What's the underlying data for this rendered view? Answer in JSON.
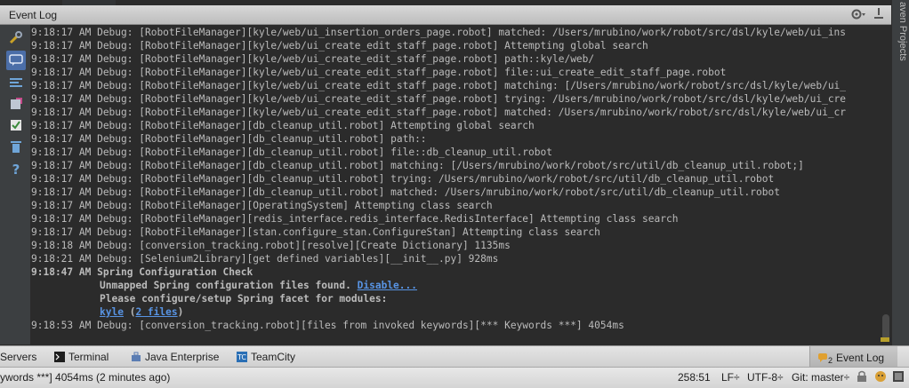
{
  "panel": {
    "title": "Event Log",
    "right_tool_label": "aven Projects"
  },
  "toolbar_icons": [
    "settings-tools-icon",
    "chat-bubble-icon",
    "scroll-lock-icon",
    "export-icon",
    "mark-read-icon",
    "trash-icon",
    "help-icon"
  ],
  "log_lines": [
    {
      "text": "9:18:17 AM Debug: [RobotFileManager][kyle/web/ui_insertion_orders_page.robot] matched: /Users/mrubino/work/robot/src/dsl/kyle/web/ui_ins",
      "bold": false
    },
    {
      "text": "9:18:17 AM Debug: [RobotFileManager][kyle/web/ui_create_edit_staff_page.robot] Attempting global search",
      "bold": false
    },
    {
      "text": "9:18:17 AM Debug: [RobotFileManager][kyle/web/ui_create_edit_staff_page.robot] path::kyle/web/",
      "bold": false
    },
    {
      "text": "9:18:17 AM Debug: [RobotFileManager][kyle/web/ui_create_edit_staff_page.robot] file::ui_create_edit_staff_page.robot",
      "bold": false
    },
    {
      "text": "9:18:17 AM Debug: [RobotFileManager][kyle/web/ui_create_edit_staff_page.robot] matching: [/Users/mrubino/work/robot/src/dsl/kyle/web/ui_",
      "bold": false
    },
    {
      "text": "9:18:17 AM Debug: [RobotFileManager][kyle/web/ui_create_edit_staff_page.robot] trying: /Users/mrubino/work/robot/src/dsl/kyle/web/ui_cre",
      "bold": false
    },
    {
      "text": "9:18:17 AM Debug: [RobotFileManager][kyle/web/ui_create_edit_staff_page.robot] matched: /Users/mrubino/work/robot/src/dsl/kyle/web/ui_cr",
      "bold": false
    },
    {
      "text": "9:18:17 AM Debug: [RobotFileManager][db_cleanup_util.robot] Attempting global search",
      "bold": false
    },
    {
      "text": "9:18:17 AM Debug: [RobotFileManager][db_cleanup_util.robot] path::",
      "bold": false
    },
    {
      "text": "9:18:17 AM Debug: [RobotFileManager][db_cleanup_util.robot] file::db_cleanup_util.robot",
      "bold": false
    },
    {
      "text": "9:18:17 AM Debug: [RobotFileManager][db_cleanup_util.robot] matching: [/Users/mrubino/work/robot/src/util/db_cleanup_util.robot;]",
      "bold": false
    },
    {
      "text": "9:18:17 AM Debug: [RobotFileManager][db_cleanup_util.robot] trying: /Users/mrubino/work/robot/src/util/db_cleanup_util.robot",
      "bold": false
    },
    {
      "text": "9:18:17 AM Debug: [RobotFileManager][db_cleanup_util.robot] matched: /Users/mrubino/work/robot/src/util/db_cleanup_util.robot",
      "bold": false
    },
    {
      "text": "9:18:17 AM Debug: [RobotFileManager][OperatingSystem] Attempting class search",
      "bold": false
    },
    {
      "text": "9:18:17 AM Debug: [RobotFileManager][redis_interface.redis_interface.RedisInterface] Attempting class search",
      "bold": false
    },
    {
      "text": "9:18:17 AM Debug: [RobotFileManager][stan.configure_stan.ConfigureStan] Attempting class search",
      "bold": false
    },
    {
      "text": "9:18:18 AM Debug: [conversion_tracking.robot][resolve][Create Dictionary] 1135ms",
      "bold": false
    },
    {
      "text": "9:18:21 AM Debug: [Selenium2Library][get defined variables][__init__.py] 928ms",
      "bold": false
    }
  ],
  "spring": {
    "header": "9:18:47 AM Spring Configuration Check",
    "line1": "Unmapped Spring configuration files found.",
    "line1_link": "Disable...",
    "line2": "Please configure/setup Spring facet for modules:",
    "module_link": "kyle",
    "paren_open": "(",
    "files_link": "2 files",
    "paren_close": ")"
  },
  "last_line": "9:18:53 AM Debug: [conversion_tracking.robot][files from invoked keywords][*** Keywords ***] 4054ms",
  "tool_windows": {
    "servers": "Servers",
    "terminal": "Terminal",
    "java_enterprise": "Java Enterprise",
    "teamcity": "TeamCity",
    "event_log_count": "2",
    "event_log": "Event Log"
  },
  "status": {
    "message": "ywords ***] 4054ms (2 minutes ago)",
    "position": "258:51",
    "line_sep": "LF÷",
    "encoding": "UTF-8÷",
    "vcs": "Git: master÷"
  },
  "colors": {
    "log_bg": "#2b2b2b",
    "log_text": "#bbbbbb",
    "link": "#5894e4",
    "marker": "#b79f2b"
  }
}
